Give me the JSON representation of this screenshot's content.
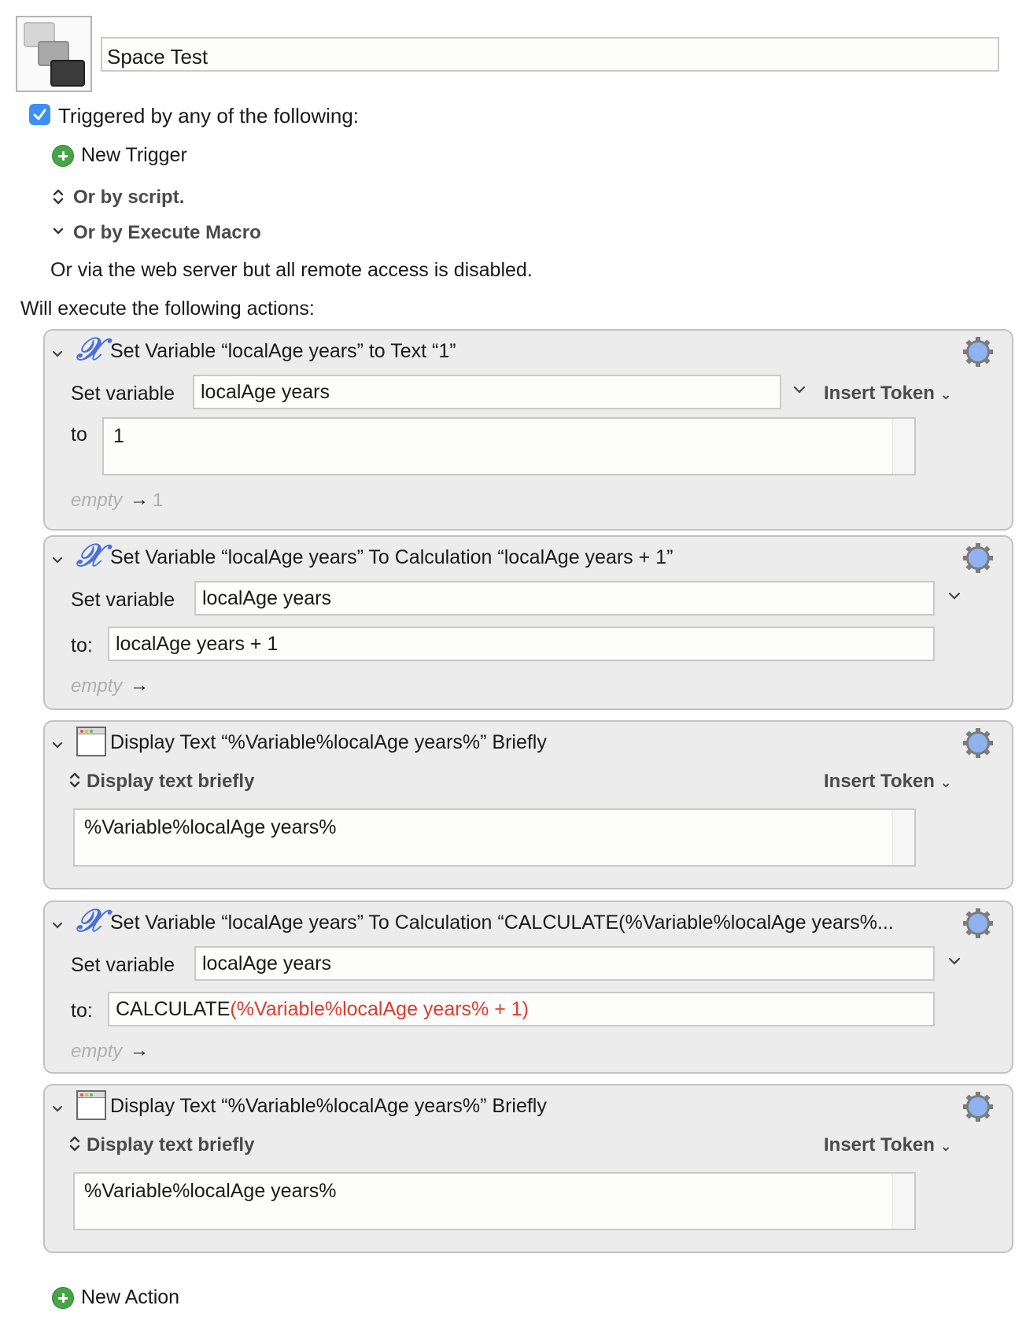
{
  "macro": {
    "name": "Space Test",
    "triggered_label": "Triggered by any of the following:",
    "triggered_checked": true,
    "new_trigger_label": "New Trigger",
    "or_by_script_label": "Or by script.",
    "or_by_execute_label": "Or by Execute Macro",
    "web_server_text": "Or via the web server but all remote access is disabled.",
    "will_execute_label": "Will execute the following actions:",
    "new_action_label": "New Action"
  },
  "actions": [
    {
      "icon": "variable-x-icon",
      "title": "Set Variable “localAge years” to Text “1”",
      "set_variable_label": "Set variable",
      "variable": "localAge years",
      "insert_token_label": "Insert Token",
      "to_label": "to",
      "value": "1",
      "empty_label": "empty",
      "result": "1"
    },
    {
      "icon": "variable-x-icon",
      "title": "Set Variable “localAge years” To Calculation “localAge years + 1”",
      "set_variable_label": "Set variable",
      "variable": "localAge years",
      "to_label": "to:",
      "value": "localAge years + 1",
      "empty_label": "empty"
    },
    {
      "icon": "display-window-icon",
      "title": "Display Text “%Variable%localAge years%” Briefly",
      "mode_label": "Display text briefly",
      "insert_token_label": "Insert Token",
      "text": "%Variable%localAge years%"
    },
    {
      "icon": "variable-x-icon",
      "title": "Set Variable “localAge years” To Calculation “CALCULATE(%Variable%localAge years%...",
      "set_variable_label": "Set variable",
      "variable": "localAge years",
      "to_label": "to:",
      "value_plain": "CALCULATE",
      "value_error": "(%Variable%localAge years% + 1)",
      "empty_label": "empty"
    },
    {
      "icon": "display-window-icon",
      "title": "Display Text “%Variable%localAge years%” Briefly",
      "mode_label": "Display text briefly",
      "insert_token_label": "Insert Token",
      "text": "%Variable%localAge years%"
    }
  ],
  "colors": {
    "accent_blue": "#3d8ef5",
    "add_green": "#47a547",
    "error_red": "#e03a2f",
    "gear_blue": "#8fb3f0"
  }
}
